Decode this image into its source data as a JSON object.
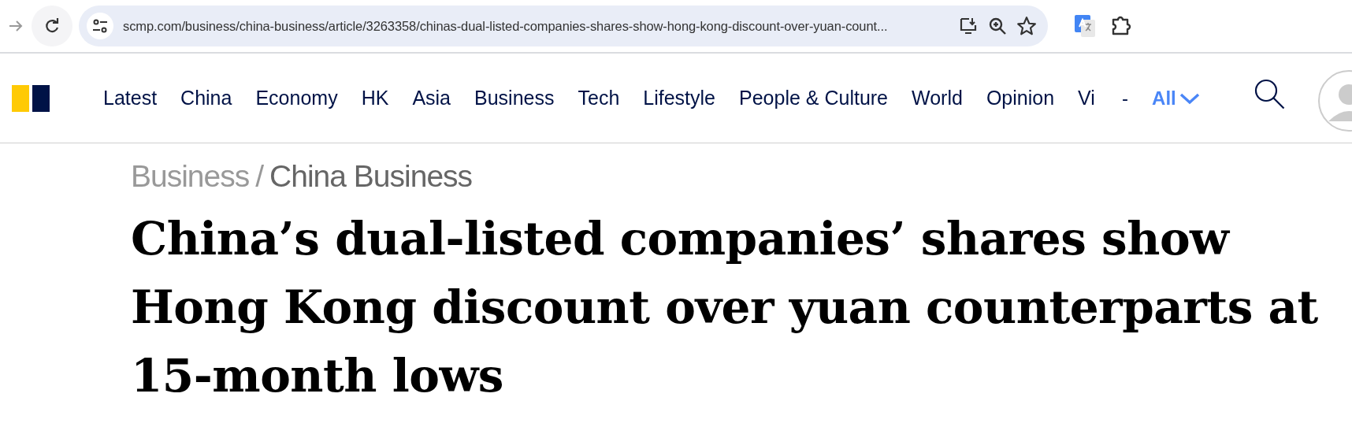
{
  "browser": {
    "url": "scmp.com/business/china-business/article/3263358/chinas-dual-listed-companies-shares-show-hong-kong-discount-over-yuan-count..."
  },
  "nav": {
    "items": [
      "Latest",
      "China",
      "Economy",
      "HK",
      "Asia",
      "Business",
      "Tech",
      "Lifestyle",
      "People & Culture",
      "World",
      "Opinion",
      "Vi"
    ],
    "separator": "-",
    "all_label": "All"
  },
  "breadcrumb": {
    "section": "Business",
    "separator": "/",
    "subsection": "China Business"
  },
  "headline": "China’s dual-listed companies’ shares show Hong Kong discount over yuan counterparts at 15-month lows"
}
